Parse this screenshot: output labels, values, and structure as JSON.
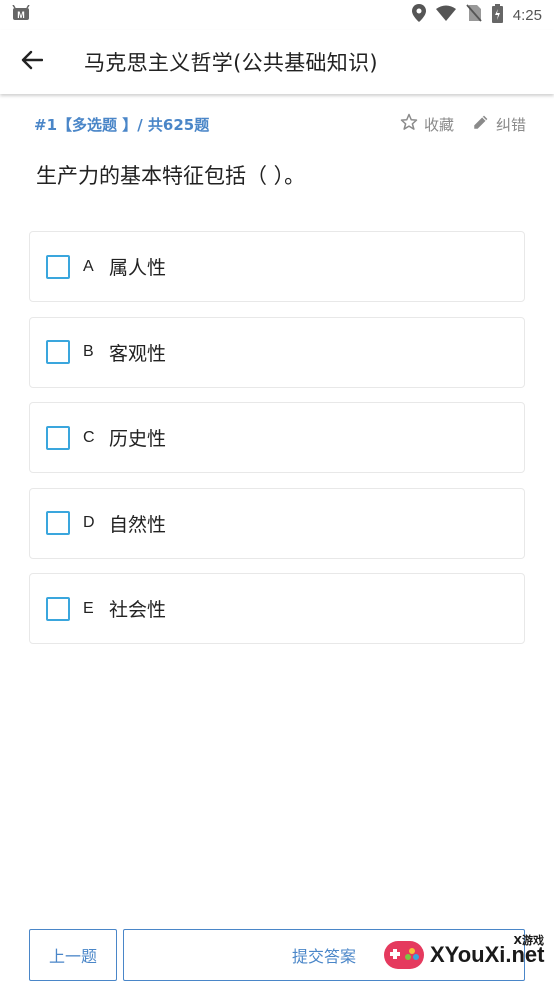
{
  "status_bar": {
    "time": "4:25",
    "icons": [
      "android-debug-icon",
      "location-icon",
      "wifi-icon",
      "no-sim-icon",
      "battery-icon"
    ]
  },
  "app_bar": {
    "title": "马克思主义哲学(公共基础知识)",
    "back_icon": "arrow-left-icon"
  },
  "question_meta": {
    "number_text": "#1【多选题 】/ 共625题",
    "favorite_label": "收藏",
    "correct_label": "纠错"
  },
  "question": {
    "text": "生产力的基本特征包括（ ）。",
    "options": [
      {
        "letter": "A",
        "text": "属人性"
      },
      {
        "letter": "B",
        "text": "客观性"
      },
      {
        "letter": "C",
        "text": "历史性"
      },
      {
        "letter": "D",
        "text": "自然性"
      },
      {
        "letter": "E",
        "text": "社会性"
      }
    ]
  },
  "bottom_bar": {
    "prev_label": "上一题",
    "submit_label": "提交答案"
  },
  "watermark": {
    "text": "XYouXi.net",
    "subtext": "X游戏"
  },
  "colors": {
    "accent": "#4a86c8",
    "checkbox": "#3aa6dd",
    "muted": "#8a8a8a"
  }
}
